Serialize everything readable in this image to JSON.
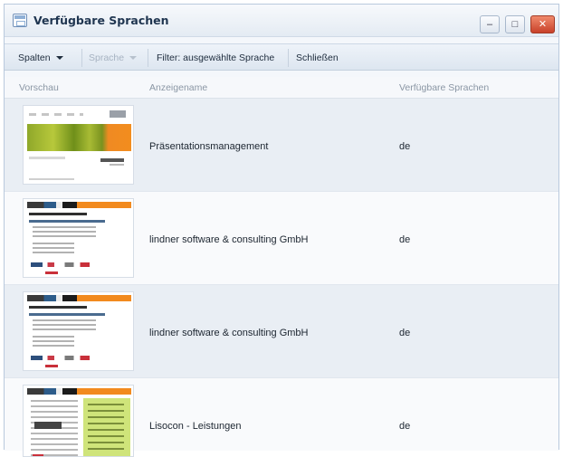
{
  "window": {
    "title": "Verfügbare Sprachen",
    "controls": {
      "minimize": "–",
      "maximize": "□",
      "close": "✕"
    }
  },
  "toolbar": {
    "columns_label": "Spalten",
    "language_label": "Sprache",
    "filter_label": "Filter: ausgewählte Sprache",
    "close_label": "Schließen"
  },
  "table": {
    "headers": [
      "Vorschau",
      "Anzeigename",
      "Verfügbare Sprachen"
    ],
    "rows": [
      {
        "name": "Präsentationsmanagement",
        "languages": "de"
      },
      {
        "name": "lindner software & consulting GmbH",
        "languages": "de"
      },
      {
        "name": "lindner software & consulting GmbH",
        "languages": "de"
      },
      {
        "name": "Lisocon - Leistungen",
        "languages": "de"
      }
    ]
  },
  "colors": {
    "accent": "#f28a1e",
    "close_button": "#c8412a",
    "row_alt": "#e9eef4"
  },
  "icons": {
    "app": "window-icon",
    "minimize": "minimize-icon",
    "maximize": "maximize-icon",
    "close": "close-icon"
  }
}
